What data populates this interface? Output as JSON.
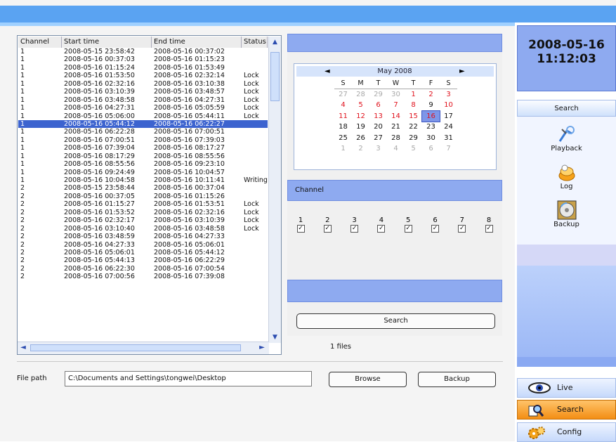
{
  "list": {
    "columns": [
      "Channel",
      "Start time",
      "End time",
      "Status"
    ],
    "rows": [
      [
        "1",
        "2008-05-15 23:58:42",
        "2008-05-16 00:37:02",
        ""
      ],
      [
        "1",
        "2008-05-16 00:37:03",
        "2008-05-16 01:15:23",
        ""
      ],
      [
        "1",
        "2008-05-16 01:15:24",
        "2008-05-16 01:53:49",
        ""
      ],
      [
        "1",
        "2008-05-16 01:53:50",
        "2008-05-16 02:32:14",
        "Lock"
      ],
      [
        "1",
        "2008-05-16 02:32:16",
        "2008-05-16 03:10:38",
        "Lock"
      ],
      [
        "1",
        "2008-05-16 03:10:39",
        "2008-05-16 03:48:57",
        "Lock"
      ],
      [
        "1",
        "2008-05-16 03:48:58",
        "2008-05-16 04:27:31",
        "Lock"
      ],
      [
        "1",
        "2008-05-16 04:27:31",
        "2008-05-16 05:05:59",
        "Lock"
      ],
      [
        "1",
        "2008-05-16 05:06:00",
        "2008-05-16 05:44:11",
        "Lock"
      ],
      [
        "1",
        "2008-05-16 05:44:12",
        "2008-05-16 06:22:27",
        ""
      ],
      [
        "1",
        "2008-05-16 06:22:28",
        "2008-05-16 07:00:51",
        ""
      ],
      [
        "1",
        "2008-05-16 07:00:51",
        "2008-05-16 07:39:03",
        ""
      ],
      [
        "1",
        "2008-05-16 07:39:04",
        "2008-05-16 08:17:27",
        ""
      ],
      [
        "1",
        "2008-05-16 08:17:29",
        "2008-05-16 08:55:56",
        ""
      ],
      [
        "1",
        "2008-05-16 08:55:56",
        "2008-05-16 09:23:10",
        ""
      ],
      [
        "1",
        "2008-05-16 09:24:49",
        "2008-05-16 10:04:57",
        ""
      ],
      [
        "1",
        "2008-05-16 10:04:58",
        "2008-05-16 10:11:41",
        "Writing"
      ],
      [
        "2",
        "2008-05-15 23:58:44",
        "2008-05-16 00:37:04",
        ""
      ],
      [
        "2",
        "2008-05-16 00:37:05",
        "2008-05-16 01:15:26",
        ""
      ],
      [
        "2",
        "2008-05-16 01:15:27",
        "2008-05-16 01:53:51",
        "Lock"
      ],
      [
        "2",
        "2008-05-16 01:53:52",
        "2008-05-16 02:32:16",
        "Lock"
      ],
      [
        "2",
        "2008-05-16 02:32:17",
        "2008-05-16 03:10:39",
        "Lock"
      ],
      [
        "2",
        "2008-05-16 03:10:40",
        "2008-05-16 03:48:58",
        "Lock"
      ],
      [
        "2",
        "2008-05-16 03:48:59",
        "2008-05-16 04:27:33",
        ""
      ],
      [
        "2",
        "2008-05-16 04:27:33",
        "2008-05-16 05:06:01",
        ""
      ],
      [
        "2",
        "2008-05-16 05:06:01",
        "2008-05-16 05:44:12",
        ""
      ],
      [
        "2",
        "2008-05-16 05:44:13",
        "2008-05-16 06:22:29",
        ""
      ],
      [
        "2",
        "2008-05-16 06:22:30",
        "2008-05-16 07:00:54",
        ""
      ],
      [
        "2",
        "2008-05-16 07:00:56",
        "2008-05-16 07:39:08",
        ""
      ]
    ],
    "selected_row": 9
  },
  "calendar": {
    "prev": "◄",
    "next": "►",
    "month": "May 2008",
    "dow": [
      "S",
      "M",
      "T",
      "W",
      "T",
      "F",
      "S"
    ],
    "weeks": [
      [
        {
          "d": "27",
          "s": "grey"
        },
        {
          "d": "28",
          "s": "grey"
        },
        {
          "d": "29",
          "s": "grey"
        },
        {
          "d": "30",
          "s": "grey"
        },
        {
          "d": "1",
          "s": "red"
        },
        {
          "d": "2",
          "s": "red"
        },
        {
          "d": "3",
          "s": "red"
        }
      ],
      [
        {
          "d": "4",
          "s": "red"
        },
        {
          "d": "5",
          "s": "red"
        },
        {
          "d": "6",
          "s": "red"
        },
        {
          "d": "7",
          "s": "red"
        },
        {
          "d": "8",
          "s": "red"
        },
        {
          "d": "9",
          "s": ""
        },
        {
          "d": "10",
          "s": "red"
        }
      ],
      [
        {
          "d": "11",
          "s": "red"
        },
        {
          "d": "12",
          "s": "red"
        },
        {
          "d": "13",
          "s": "red"
        },
        {
          "d": "14",
          "s": "red"
        },
        {
          "d": "15",
          "s": "red"
        },
        {
          "d": "16",
          "s": "today"
        },
        {
          "d": "17",
          "s": ""
        }
      ],
      [
        {
          "d": "18",
          "s": ""
        },
        {
          "d": "19",
          "s": ""
        },
        {
          "d": "20",
          "s": ""
        },
        {
          "d": "21",
          "s": ""
        },
        {
          "d": "22",
          "s": ""
        },
        {
          "d": "23",
          "s": ""
        },
        {
          "d": "24",
          "s": ""
        }
      ],
      [
        {
          "d": "25",
          "s": ""
        },
        {
          "d": "26",
          "s": ""
        },
        {
          "d": "27",
          "s": ""
        },
        {
          "d": "28",
          "s": ""
        },
        {
          "d": "29",
          "s": ""
        },
        {
          "d": "30",
          "s": ""
        },
        {
          "d": "31",
          "s": ""
        }
      ],
      [
        {
          "d": "1",
          "s": "grey"
        },
        {
          "d": "2",
          "s": "grey"
        },
        {
          "d": "3",
          "s": "grey"
        },
        {
          "d": "4",
          "s": "grey"
        },
        {
          "d": "5",
          "s": "grey"
        },
        {
          "d": "6",
          "s": "grey"
        },
        {
          "d": "7",
          "s": "grey"
        }
      ]
    ]
  },
  "channel": {
    "title": "Channel",
    "items": [
      {
        "num": "1",
        "checked": true
      },
      {
        "num": "2",
        "checked": true
      },
      {
        "num": "3",
        "checked": true
      },
      {
        "num": "4",
        "checked": true
      },
      {
        "num": "5",
        "checked": true
      },
      {
        "num": "6",
        "checked": true
      },
      {
        "num": "7",
        "checked": true
      },
      {
        "num": "8",
        "checked": true
      }
    ]
  },
  "search": {
    "button_label": "Search",
    "result": "1 files"
  },
  "filepath": {
    "label": "File path",
    "value": "C:\\Documents and Settings\\tongwei\\Desktop",
    "browse_label": "Browse",
    "backup_label": "Backup"
  },
  "sidebar": {
    "date": "2008-05-16",
    "time": "11:12:03",
    "section_title": "Search",
    "tools": [
      {
        "label": "Playback",
        "icon": "playback-icon"
      },
      {
        "label": "Log",
        "icon": "log-icon"
      },
      {
        "label": "Backup",
        "icon": "backup-icon"
      }
    ],
    "nav": [
      {
        "label": "Live",
        "icon": "eye-icon"
      },
      {
        "label": "Search",
        "icon": "search-icon"
      },
      {
        "label": "Config",
        "icon": "config-icon"
      }
    ]
  },
  "colors": {
    "selected_row": "#3c63cf",
    "panel_bar": "#8eaaf0",
    "active_nav": "#f38e14",
    "holiday_red": "#e0111c"
  }
}
